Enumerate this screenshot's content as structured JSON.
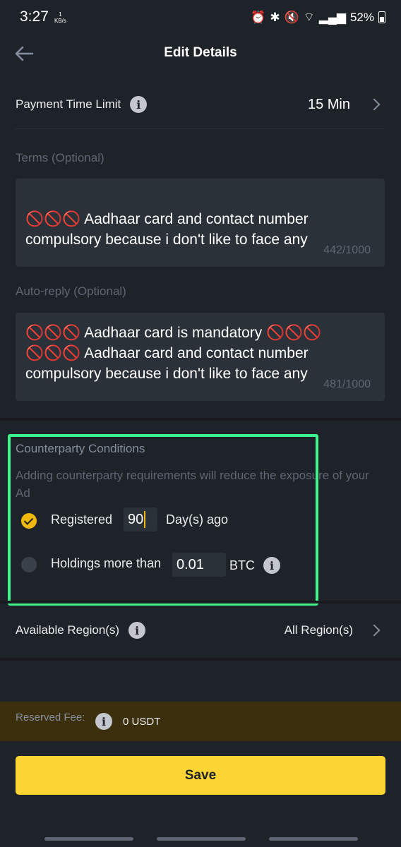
{
  "status_bar": {
    "time": "3:27",
    "net_speed_value": "1",
    "net_speed_unit": "KB/s",
    "battery": "52%"
  },
  "header": {
    "title": "Edit Details"
  },
  "payment_time_limit": {
    "label": "Payment Time Limit",
    "value": "15 Min"
  },
  "terms": {
    "label": "Terms (Optional)",
    "text": "🚫🚫🚫 Aadhaar card and contact number\ncompulsory because i don't like to face any",
    "counter": "442/1000"
  },
  "auto_reply": {
    "label": "Auto-reply (Optional)",
    "text": "🚫🚫🚫 Aadhaar card is mandatory 🚫🚫🚫\n🚫🚫🚫 Aadhaar card and contact number\ncompulsory because i don't like to face any",
    "counter": "481/1000"
  },
  "counterparty": {
    "title": "Counterparty Conditions",
    "description": "Adding counterparty requirements will reduce the exposure of your Ad",
    "registered": {
      "label": "Registered",
      "value": "90",
      "suffix": "Day(s) ago",
      "checked": true
    },
    "holdings": {
      "label": "Holdings more than",
      "value": "0.01",
      "suffix": "BTC",
      "checked": false
    }
  },
  "available_regions": {
    "label": "Available Region(s)",
    "value": "All Region(s)"
  },
  "reserved_fee": {
    "label": "Reserved Fee:",
    "value": "0 USDT"
  },
  "save_label": "Save",
  "colors": {
    "background": "#1e2329",
    "accent": "#fcd535",
    "highlight": "#3ef58c"
  }
}
